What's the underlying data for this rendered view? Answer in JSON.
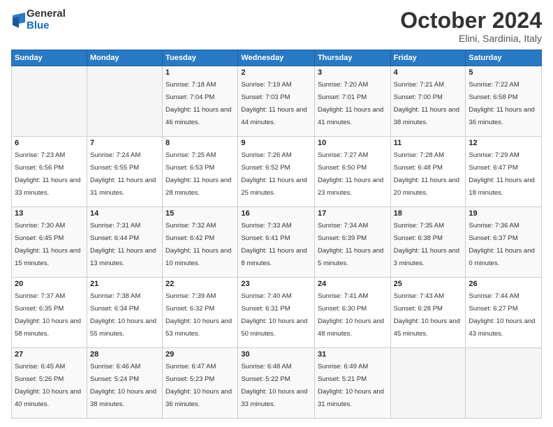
{
  "logo": {
    "general": "General",
    "blue": "Blue"
  },
  "title": {
    "month": "October 2024",
    "location": "Elini, Sardinia, Italy"
  },
  "headers": [
    "Sunday",
    "Monday",
    "Tuesday",
    "Wednesday",
    "Thursday",
    "Friday",
    "Saturday"
  ],
  "weeks": [
    [
      {
        "day": "",
        "sunrise": "",
        "sunset": "",
        "daylight": ""
      },
      {
        "day": "",
        "sunrise": "",
        "sunset": "",
        "daylight": ""
      },
      {
        "day": "1",
        "sunrise": "Sunrise: 7:18 AM",
        "sunset": "Sunset: 7:04 PM",
        "daylight": "Daylight: 11 hours and 46 minutes."
      },
      {
        "day": "2",
        "sunrise": "Sunrise: 7:19 AM",
        "sunset": "Sunset: 7:03 PM",
        "daylight": "Daylight: 11 hours and 44 minutes."
      },
      {
        "day": "3",
        "sunrise": "Sunrise: 7:20 AM",
        "sunset": "Sunset: 7:01 PM",
        "daylight": "Daylight: 11 hours and 41 minutes."
      },
      {
        "day": "4",
        "sunrise": "Sunrise: 7:21 AM",
        "sunset": "Sunset: 7:00 PM",
        "daylight": "Daylight: 11 hours and 38 minutes."
      },
      {
        "day": "5",
        "sunrise": "Sunrise: 7:22 AM",
        "sunset": "Sunset: 6:58 PM",
        "daylight": "Daylight: 11 hours and 36 minutes."
      }
    ],
    [
      {
        "day": "6",
        "sunrise": "Sunrise: 7:23 AM",
        "sunset": "Sunset: 6:56 PM",
        "daylight": "Daylight: 11 hours and 33 minutes."
      },
      {
        "day": "7",
        "sunrise": "Sunrise: 7:24 AM",
        "sunset": "Sunset: 6:55 PM",
        "daylight": "Daylight: 11 hours and 31 minutes."
      },
      {
        "day": "8",
        "sunrise": "Sunrise: 7:25 AM",
        "sunset": "Sunset: 6:53 PM",
        "daylight": "Daylight: 11 hours and 28 minutes."
      },
      {
        "day": "9",
        "sunrise": "Sunrise: 7:26 AM",
        "sunset": "Sunset: 6:52 PM",
        "daylight": "Daylight: 11 hours and 25 minutes."
      },
      {
        "day": "10",
        "sunrise": "Sunrise: 7:27 AM",
        "sunset": "Sunset: 6:50 PM",
        "daylight": "Daylight: 11 hours and 23 minutes."
      },
      {
        "day": "11",
        "sunrise": "Sunrise: 7:28 AM",
        "sunset": "Sunset: 6:48 PM",
        "daylight": "Daylight: 11 hours and 20 minutes."
      },
      {
        "day": "12",
        "sunrise": "Sunrise: 7:29 AM",
        "sunset": "Sunset: 6:47 PM",
        "daylight": "Daylight: 11 hours and 18 minutes."
      }
    ],
    [
      {
        "day": "13",
        "sunrise": "Sunrise: 7:30 AM",
        "sunset": "Sunset: 6:45 PM",
        "daylight": "Daylight: 11 hours and 15 minutes."
      },
      {
        "day": "14",
        "sunrise": "Sunrise: 7:31 AM",
        "sunset": "Sunset: 6:44 PM",
        "daylight": "Daylight: 11 hours and 13 minutes."
      },
      {
        "day": "15",
        "sunrise": "Sunrise: 7:32 AM",
        "sunset": "Sunset: 6:42 PM",
        "daylight": "Daylight: 11 hours and 10 minutes."
      },
      {
        "day": "16",
        "sunrise": "Sunrise: 7:33 AM",
        "sunset": "Sunset: 6:41 PM",
        "daylight": "Daylight: 11 hours and 8 minutes."
      },
      {
        "day": "17",
        "sunrise": "Sunrise: 7:34 AM",
        "sunset": "Sunset: 6:39 PM",
        "daylight": "Daylight: 11 hours and 5 minutes."
      },
      {
        "day": "18",
        "sunrise": "Sunrise: 7:35 AM",
        "sunset": "Sunset: 6:38 PM",
        "daylight": "Daylight: 11 hours and 3 minutes."
      },
      {
        "day": "19",
        "sunrise": "Sunrise: 7:36 AM",
        "sunset": "Sunset: 6:37 PM",
        "daylight": "Daylight: 11 hours and 0 minutes."
      }
    ],
    [
      {
        "day": "20",
        "sunrise": "Sunrise: 7:37 AM",
        "sunset": "Sunset: 6:35 PM",
        "daylight": "Daylight: 10 hours and 58 minutes."
      },
      {
        "day": "21",
        "sunrise": "Sunrise: 7:38 AM",
        "sunset": "Sunset: 6:34 PM",
        "daylight": "Daylight: 10 hours and 55 minutes."
      },
      {
        "day": "22",
        "sunrise": "Sunrise: 7:39 AM",
        "sunset": "Sunset: 6:32 PM",
        "daylight": "Daylight: 10 hours and 53 minutes."
      },
      {
        "day": "23",
        "sunrise": "Sunrise: 7:40 AM",
        "sunset": "Sunset: 6:31 PM",
        "daylight": "Daylight: 10 hours and 50 minutes."
      },
      {
        "day": "24",
        "sunrise": "Sunrise: 7:41 AM",
        "sunset": "Sunset: 6:30 PM",
        "daylight": "Daylight: 10 hours and 48 minutes."
      },
      {
        "day": "25",
        "sunrise": "Sunrise: 7:43 AM",
        "sunset": "Sunset: 6:28 PM",
        "daylight": "Daylight: 10 hours and 45 minutes."
      },
      {
        "day": "26",
        "sunrise": "Sunrise: 7:44 AM",
        "sunset": "Sunset: 6:27 PM",
        "daylight": "Daylight: 10 hours and 43 minutes."
      }
    ],
    [
      {
        "day": "27",
        "sunrise": "Sunrise: 6:45 AM",
        "sunset": "Sunset: 5:26 PM",
        "daylight": "Daylight: 10 hours and 40 minutes."
      },
      {
        "day": "28",
        "sunrise": "Sunrise: 6:46 AM",
        "sunset": "Sunset: 5:24 PM",
        "daylight": "Daylight: 10 hours and 38 minutes."
      },
      {
        "day": "29",
        "sunrise": "Sunrise: 6:47 AM",
        "sunset": "Sunset: 5:23 PM",
        "daylight": "Daylight: 10 hours and 36 minutes."
      },
      {
        "day": "30",
        "sunrise": "Sunrise: 6:48 AM",
        "sunset": "Sunset: 5:22 PM",
        "daylight": "Daylight: 10 hours and 33 minutes."
      },
      {
        "day": "31",
        "sunrise": "Sunrise: 6:49 AM",
        "sunset": "Sunset: 5:21 PM",
        "daylight": "Daylight: 10 hours and 31 minutes."
      },
      {
        "day": "",
        "sunrise": "",
        "sunset": "",
        "daylight": ""
      },
      {
        "day": "",
        "sunrise": "",
        "sunset": "",
        "daylight": ""
      }
    ]
  ]
}
